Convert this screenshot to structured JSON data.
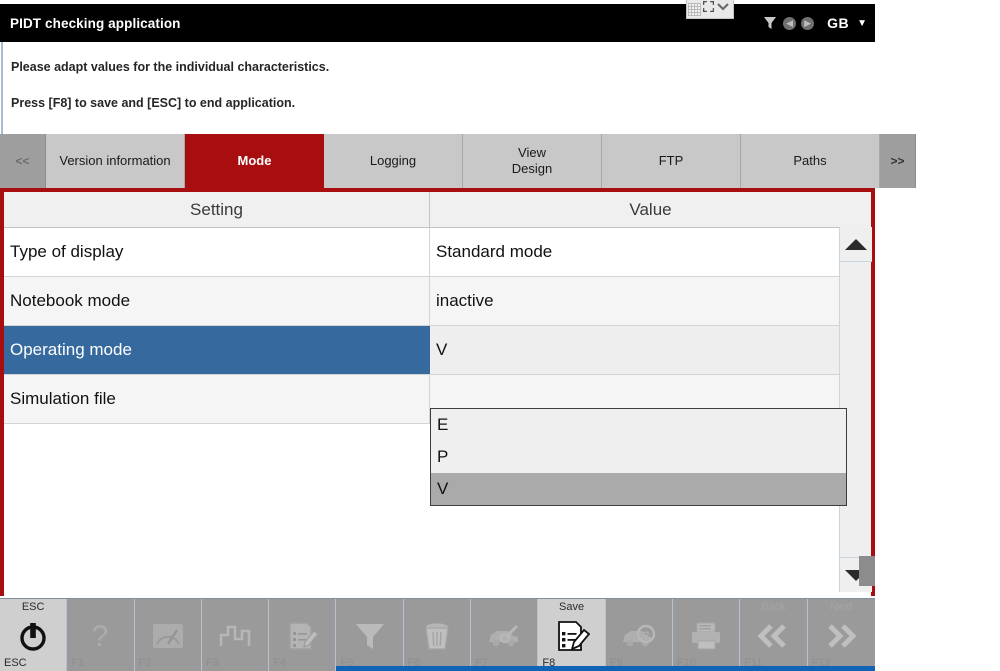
{
  "window": {
    "app_title": "PIDT checking application",
    "language": "GB",
    "language_caret": "▼"
  },
  "titlebar_icons": [
    {
      "name": "funnel-icon"
    },
    {
      "name": "circle-left-icon",
      "glyph": "◀"
    },
    {
      "name": "circle-right-icon",
      "glyph": "▶"
    }
  ],
  "float_toolbar": {
    "grid_icon": "grid-icon",
    "expand_icon": "expand-icon",
    "chevron_icon": "chevron-down-icon"
  },
  "instructions": {
    "line1": "Please adapt values for the individual characteristics.",
    "line2": "Press [F8] to save and [ESC] to end application."
  },
  "tabs": {
    "prev_label": "<<",
    "next_label": ">>",
    "items": [
      {
        "label": "Version information",
        "active": false
      },
      {
        "label": "Mode",
        "active": true
      },
      {
        "label": "Logging",
        "active": false
      },
      {
        "label": "View\nDesign",
        "line1": "View",
        "line2": "Design",
        "active": false
      },
      {
        "label": "FTP",
        "active": false
      },
      {
        "label": "Paths",
        "active": false
      }
    ]
  },
  "table": {
    "columns": [
      "Setting",
      "Value"
    ],
    "rows": [
      {
        "setting": "Type of display",
        "value": "Standard mode",
        "selected": false
      },
      {
        "setting": "Notebook mode",
        "value": "inactive",
        "selected": false
      },
      {
        "setting": "Operating mode",
        "value": "V",
        "selected": true,
        "is_combo": true
      },
      {
        "setting": "Simulation file",
        "value": "",
        "selected": false
      }
    ]
  },
  "dropdown": {
    "open": true,
    "options": [
      {
        "label": "E",
        "highlighted": false
      },
      {
        "label": "P",
        "highlighted": false
      },
      {
        "label": "V",
        "highlighted": true
      }
    ]
  },
  "scrollbar": {
    "up_label": "scroll-up",
    "down_label": "scroll-down"
  },
  "function_keys": [
    {
      "key": "ESC",
      "top": "ESC",
      "icon": "power-icon",
      "enabled": true
    },
    {
      "key": "F1",
      "top": "",
      "icon": "help-question-icon",
      "enabled": false
    },
    {
      "key": "F2",
      "top": "",
      "icon": "gauge-icon",
      "enabled": false
    },
    {
      "key": "F3",
      "top": "",
      "icon": "bar-chart-icon",
      "enabled": false
    },
    {
      "key": "F4",
      "top": "",
      "icon": "edit-document-icon",
      "enabled": false
    },
    {
      "key": "F5",
      "top": "",
      "icon": "funnel-icon",
      "enabled": false
    },
    {
      "key": "F6",
      "top": "",
      "icon": "trash-icon",
      "enabled": false
    },
    {
      "key": "F7",
      "top": "",
      "icon": "car-key-icon",
      "enabled": false
    },
    {
      "key": "F8",
      "top": "Save",
      "icon": "save-document-icon",
      "enabled": true
    },
    {
      "key": "F9",
      "top": "",
      "icon": "car-search-icon",
      "enabled": false
    },
    {
      "key": "F10",
      "top": "",
      "icon": "printer-icon",
      "enabled": false
    },
    {
      "key": "F11",
      "top": "Back",
      "icon": "double-chevron-left-icon",
      "enabled": false
    },
    {
      "key": "F12",
      "top": "Next",
      "icon": "double-chevron-right-icon",
      "enabled": false
    }
  ],
  "colors": {
    "accent_red": "#a80d10",
    "selected_blue": "#36699e",
    "titlebar_black": "#000000",
    "bottom_blue": "#1164b4",
    "toolbar_gray": "#9a9a9a"
  }
}
